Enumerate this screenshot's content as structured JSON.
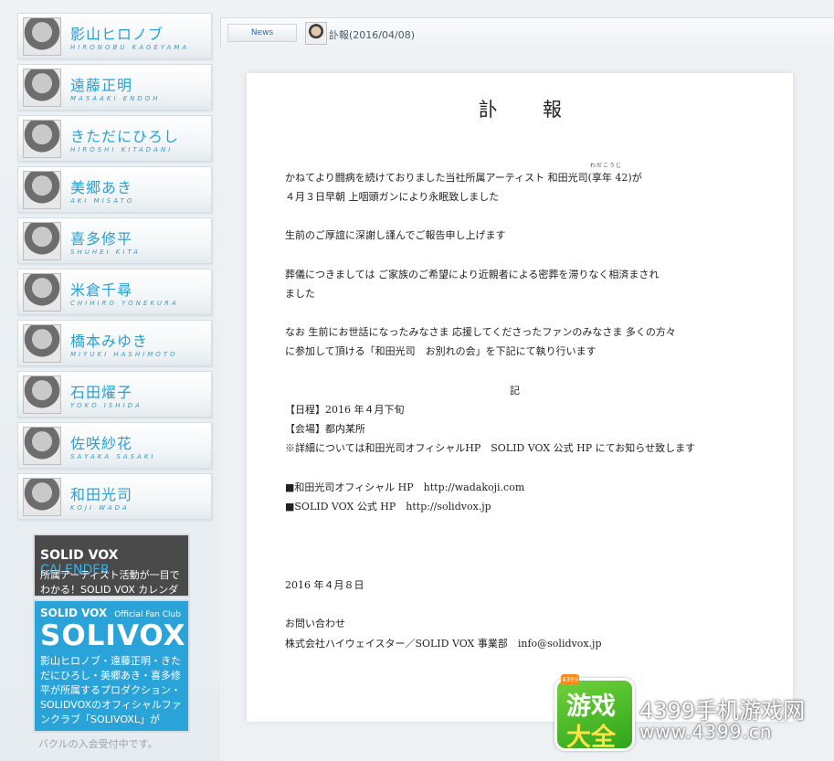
{
  "artists": [
    {
      "name_jp": "影山ヒロノブ",
      "name_en": "HIRONOBU KAGEYAMA"
    },
    {
      "name_jp": "遠藤正明",
      "name_en": "MASAAKI ENDOH"
    },
    {
      "name_jp": "きただにひろし",
      "name_en": "HIROSHI KITADANI"
    },
    {
      "name_jp": "美郷あき",
      "name_en": "AKI MISATO"
    },
    {
      "name_jp": "喜多修平",
      "name_en": "SHUHEI KITA"
    },
    {
      "name_jp": "米倉千尋",
      "name_en": "CHIHIRO YONEKURA"
    },
    {
      "name_jp": "橋本みゆき",
      "name_en": "MIYUKI HASHIMOTO"
    },
    {
      "name_jp": "石田燿子",
      "name_en": "YOKO ISHIDA"
    },
    {
      "name_jp": "佐咲紗花",
      "name_en": "SAYAKA SASAKI"
    },
    {
      "name_jp": "和田光司",
      "name_en": "KOJI WADA"
    }
  ],
  "banners": {
    "calendar_title": "SOLID VOX",
    "calendar_title_accent": "CALENDER",
    "calendar_text": "所属アーティスト活動が一目でわかる！SOLID VOX カレンダー！",
    "fanclub_brand": "SOLID VOX",
    "fanclub_sub": "Official Fan Club",
    "fanclub_logo": "SOLIVOXL",
    "fanclub_text": "影山ヒロノブ・遠藤正明・きただにひろし・美郷あき・喜多修平が所属するプロダクション・SOLIDVOXのオフィシャルファンクラブ「SOLIVOXL」が",
    "fanclub_tail": "バクルの入会受付中です。"
  },
  "tabs": {
    "news_label": "News",
    "title": "訃報(2016/04/08)"
  },
  "doc": {
    "title": "訃　報",
    "ruby": "わだこうじ",
    "lines": [
      "かねてより闘病を続けておりました当社所属アーティスト 和田光司(享年 42)が",
      "４月３日早朝 上咽頭ガンにより永眠致しました",
      "生前のご厚誼に深謝し謹んでご報告申し上げます",
      "葬儀につきましては ご家族のご希望により近親者による密葬を滞りなく相済まされ",
      "ました",
      "なお 生前にお世話になったみなさま 応援してくださったファンのみなさま 多くの方々",
      "に参加して頂ける「和田光司　お別れの会」を下記にて執り行います",
      "【日程】2016 年４月下旬",
      "【会場】都内某所",
      "※詳細については和田光司オフィシャルHP　SOLID VOX 公式 HP にてお知らせ致します",
      "■和田光司オフィシャル HP　http://wadakoji.com",
      "■SOLID VOX 公式 HP　http://solidvox.jp",
      "2016 年４月８日",
      "お問い合わせ",
      "株式会社ハイウェイスター／SOLID VOX 事業部　info@solidvox.jp"
    ],
    "ki": "記"
  },
  "watermark": {
    "badge": "4399",
    "line1": "游戏",
    "line2": "大全",
    "site_name": "4399手机游戏网",
    "site_url": "www.4399.cn"
  }
}
